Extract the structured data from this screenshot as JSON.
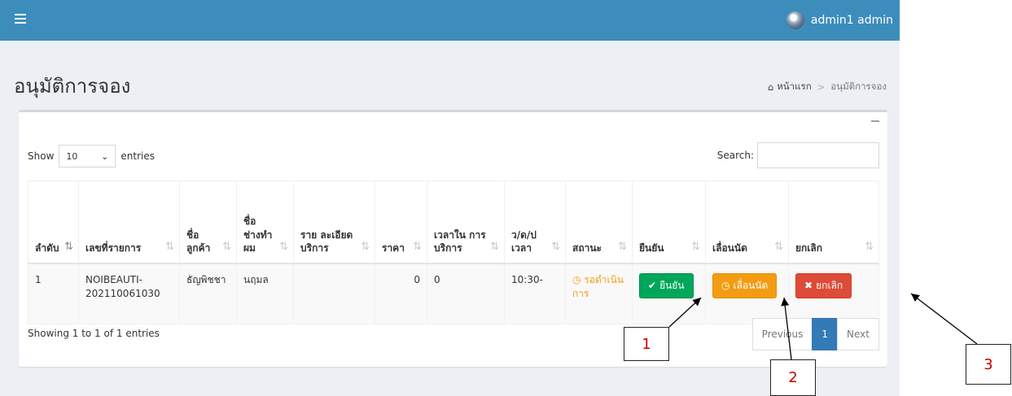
{
  "header": {
    "user_name": "admin1 admin"
  },
  "page": {
    "title": "อนุมัติการจอง"
  },
  "breadcrumb": {
    "home": "หน้าแรก",
    "current": "อนุมัติการจอง"
  },
  "table_controls": {
    "show_label": "Show",
    "entries_value": "10",
    "entries_label": "entries",
    "search_label": "Search:",
    "search_value": ""
  },
  "table": {
    "columns": [
      "ลำดับ",
      "เลขที่รายการ",
      "ชื่อ ลูกค้า",
      "ชื่อ ช่างทำ ผม",
      "ราย ละเอียด บริการ",
      "ราคา",
      "เวลาใน การ บริการ",
      "ว/ด/ป เวลา",
      "สถานะ",
      "ยืนยัน",
      "เลื่อนนัด",
      "ยกเลิก"
    ],
    "rows": [
      {
        "index": "1",
        "booking_no": "NOIBEAUTI-202110061030",
        "customer": "ธัญพิชชา",
        "stylist": "นฤมล",
        "details": "",
        "price": "0",
        "duration": "0",
        "datetime": "10:30-",
        "status": "รอดำเนินการ",
        "confirm_label": "ยืนยัน",
        "postpone_label": "เลื่อนนัด",
        "cancel_label": "ยกเลิก"
      }
    ]
  },
  "footer": {
    "info": "Showing 1 to 1 of 1 entries",
    "prev": "Previous",
    "page": "1",
    "next": "Next"
  },
  "annotations": {
    "one": "1",
    "two": "2",
    "three": "3"
  },
  "colors": {
    "header": "#3c8dbc",
    "confirm": "#00a65a",
    "postpone": "#f39c12",
    "cancel": "#dd4b39",
    "annotation_text": "#cc0000"
  }
}
